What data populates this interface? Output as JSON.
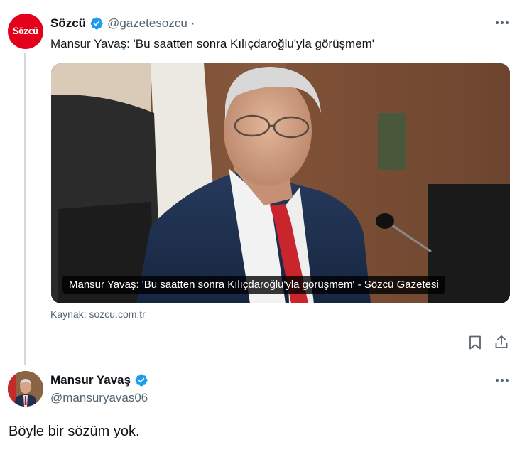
{
  "tweet1": {
    "author_logo_text": "Sözcü",
    "author_name": "Sözcü",
    "author_handle": "@gazetesozcu",
    "separator": "·",
    "text": "Mansur Yavaş: 'Bu saatten sonra Kılıçdaroğlu'yla görüşmem'",
    "card": {
      "caption": "Mansur Yavaş: 'Bu saatten sonra Kılıçdaroğlu'yla görüşmem' - Sözcü Gazetesi",
      "image_desc": "mansur-yavas-photo"
    },
    "source_label": "Kaynak: sozcu.com.tr",
    "actions": {
      "bookmark_icon": "bookmark-icon",
      "share_icon": "share-icon"
    },
    "more_icon": "more-icon"
  },
  "tweet2": {
    "author_name": "Mansur Yavaş",
    "author_handle": "@mansuryavas06",
    "text": "Böyle bir sözüm yok.",
    "more_icon": "more-icon"
  },
  "colors": {
    "verified_blue": "#1d9bf0",
    "secondary_text": "#536471",
    "brand_red": "#e2001a",
    "thread_line": "#cfd9de"
  }
}
